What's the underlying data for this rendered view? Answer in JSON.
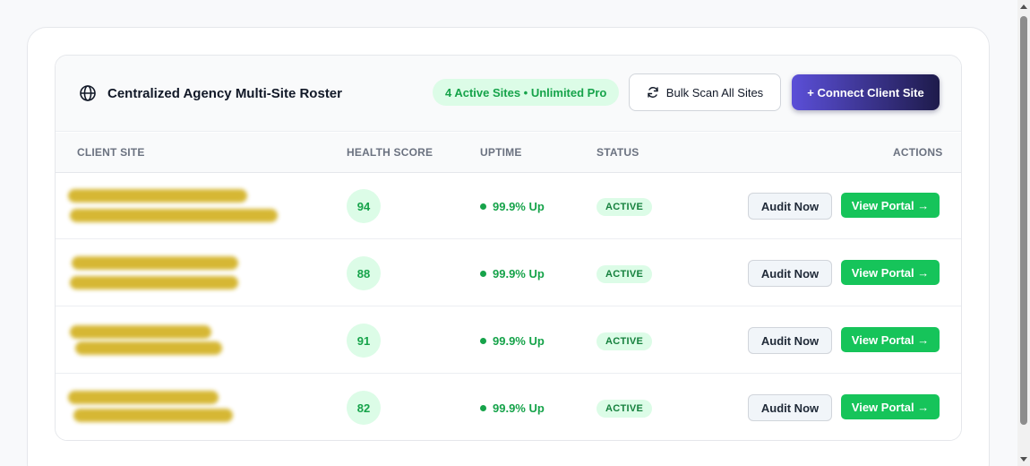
{
  "header": {
    "title": "Centralized Agency Multi-Site Roster",
    "title_icon": "globe-icon",
    "active_pill": "4 Active Sites • Unlimited Pro",
    "bulk_scan_label": "Bulk Scan All Sites",
    "bulk_scan_icon": "refresh-icon",
    "connect_label": "+ Connect Client Site"
  },
  "table": {
    "columns": [
      "CLIENT SITE",
      "HEALTH SCORE",
      "UPTIME",
      "STATUS",
      "ACTIONS"
    ],
    "rows": [
      {
        "health_score": "94",
        "uptime": "99.9% Up",
        "status": "ACTIVE",
        "audit_label": "Audit Now",
        "portal_label": "View Portal →"
      },
      {
        "health_score": "88",
        "uptime": "99.9% Up",
        "status": "ACTIVE",
        "audit_label": "Audit Now",
        "portal_label": "View Portal →"
      },
      {
        "health_score": "91",
        "uptime": "99.9% Up",
        "status": "ACTIVE",
        "audit_label": "Audit Now",
        "portal_label": "View Portal →"
      },
      {
        "health_score": "82",
        "uptime": "99.9% Up",
        "status": "ACTIVE",
        "audit_label": "Audit Now",
        "portal_label": "View Portal →"
      }
    ]
  },
  "colors": {
    "accent_green": "#16c45a",
    "status_green": "#16a34a",
    "connect_gradient_start": "#5b4fd8",
    "connect_gradient_end": "#1e1b4b",
    "redaction": "#d4b42a"
  }
}
